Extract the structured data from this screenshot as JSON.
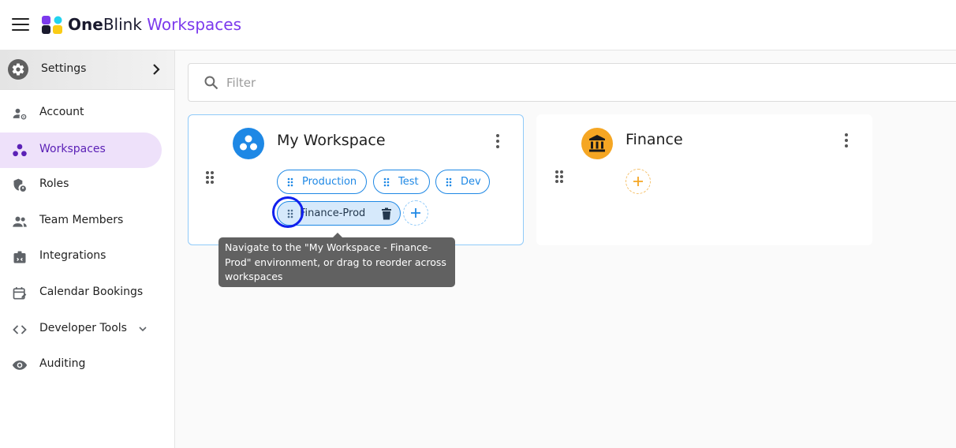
{
  "header": {
    "brand_bold": "One",
    "brand_regular": "Blink",
    "brand_accent": " Workspaces",
    "accent_color": "#7c3aed"
  },
  "sidebar": {
    "settings_label": "Settings",
    "items": [
      {
        "label": "Account",
        "icon": "account-settings-icon"
      },
      {
        "label": "Workspaces",
        "icon": "workspaces-icon",
        "active": true
      },
      {
        "label": "Roles",
        "icon": "roles-icon"
      },
      {
        "label": "Team Members",
        "icon": "team-members-icon"
      },
      {
        "label": "Integrations",
        "icon": "integrations-icon"
      },
      {
        "label": "Calendar Bookings",
        "icon": "calendar-icon"
      },
      {
        "label": "Developer Tools",
        "icon": "code-icon",
        "expandable": true
      },
      {
        "label": "Auditing",
        "icon": "eye-icon"
      }
    ]
  },
  "filter": {
    "placeholder": "Filter",
    "value": ""
  },
  "workspaces": [
    {
      "name": "My Workspace",
      "avatar_color": "#1e88e5",
      "environments": [
        "Production",
        "Test",
        "Dev",
        "Finance-Prod"
      ],
      "selected_environment": "Finance-Prod"
    },
    {
      "name": "Finance",
      "avatar_color": "#f5a623",
      "environments": []
    }
  ],
  "tooltip": {
    "text": "Navigate to the \"My Workspace - Finance-Prod\" environment, or drag to reorder across workspaces"
  }
}
